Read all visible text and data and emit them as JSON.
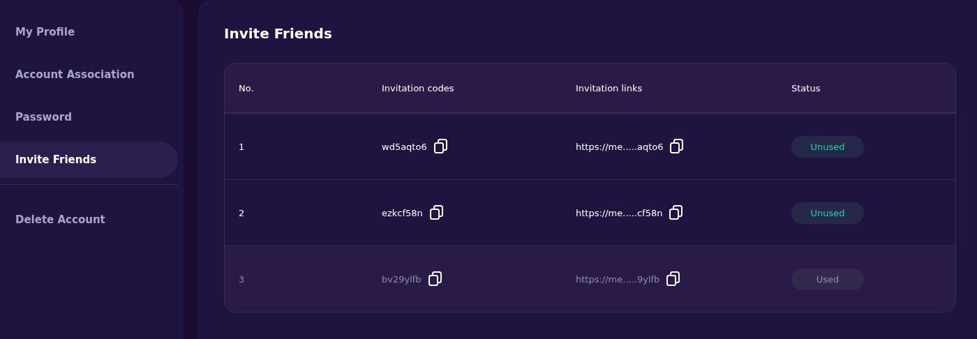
{
  "sidebar": {
    "items": [
      {
        "label": "My Profile",
        "selected": false
      },
      {
        "label": "Account Association",
        "selected": false
      },
      {
        "label": "Password",
        "selected": false
      },
      {
        "label": "Invite Friends",
        "selected": true
      }
    ],
    "footer_items": [
      {
        "label": "Delete Account",
        "selected": false
      }
    ]
  },
  "main": {
    "title": "Invite Friends",
    "table": {
      "columns": [
        "No.",
        "Invitation codes",
        "Invitation links",
        "Status"
      ],
      "rows": [
        {
          "no": "1",
          "code": "wd5aqto6",
          "link": "https://me.....aqto6",
          "status": "Unused",
          "used": false
        },
        {
          "no": "2",
          "code": "ezkcf58n",
          "link": "https://me.....cf58n",
          "status": "Unused",
          "used": false
        },
        {
          "no": "3",
          "code": "bv29ylfb",
          "link": "https://me.....9ylfb",
          "status": "Used",
          "used": true
        }
      ]
    }
  }
}
